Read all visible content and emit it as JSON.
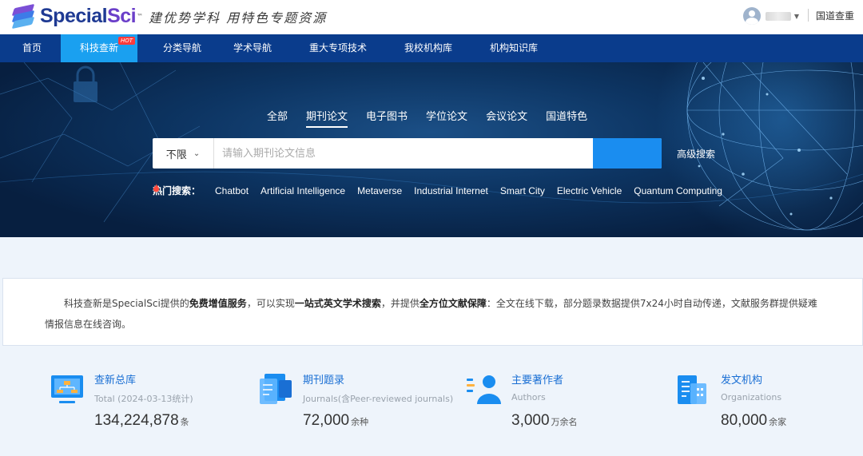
{
  "header": {
    "logo_text_a": "Special",
    "logo_text_b": "Sci",
    "logo_tm": "™",
    "slogan": "建优势学科 用特色专题资源",
    "top_link": "国道查重"
  },
  "nav": {
    "items": [
      {
        "label": "首页"
      },
      {
        "label": "科技查新",
        "badge": "HOT"
      },
      {
        "label": "分类导航"
      },
      {
        "label": "学术导航"
      },
      {
        "label": "重大专项技术"
      },
      {
        "label": "我校机构库"
      },
      {
        "label": "机构知识库"
      }
    ]
  },
  "search": {
    "tabs": [
      "全部",
      "期刊论文",
      "电子图书",
      "学位论文",
      "会议论文",
      "国道特色"
    ],
    "active_tab": "期刊论文",
    "scope": "不限",
    "placeholder": "请输入期刊论文信息",
    "advanced": "高级搜索",
    "hot_label": "热门搜索：",
    "hot_keywords": [
      "Chatbot",
      "Artificial Intelligence",
      "Metaverse",
      "Industrial Internet",
      "Smart City",
      "Electric Vehicle",
      "Quantum Computing"
    ]
  },
  "intro": {
    "p1": "科技查新是SpecialSci提供的",
    "b1": "免费增值服务",
    "p2": "，可以实现",
    "b2": "一站式英文学术搜索",
    "p3": "，并提供",
    "b3": "全方位文献保障",
    "p4": "：全文在线下载，部分题录数据提供7x24小时自动传递，文献服务群提供疑难情报信息在线咨询。"
  },
  "stats": [
    {
      "title": "查新总库",
      "sub": "Total (2024-03-13统计)",
      "num": "134,224,878",
      "unit": "条"
    },
    {
      "title": "期刊题录",
      "sub": "Journals(含Peer-reviewed journals)",
      "num": "72,000",
      "unit": "余种"
    },
    {
      "title": "主要著作者",
      "sub": "Authors",
      "num": "3,000",
      "unit": "万余名"
    },
    {
      "title": "发文机构",
      "sub": "Organizations",
      "num": "80,000",
      "unit": "余家"
    }
  ],
  "colors": {
    "nav_bg": "#0a3c8c",
    "nav_active": "#1aa0f0",
    "accent": "#1a8df0",
    "stat_title": "#1a6fd4"
  }
}
